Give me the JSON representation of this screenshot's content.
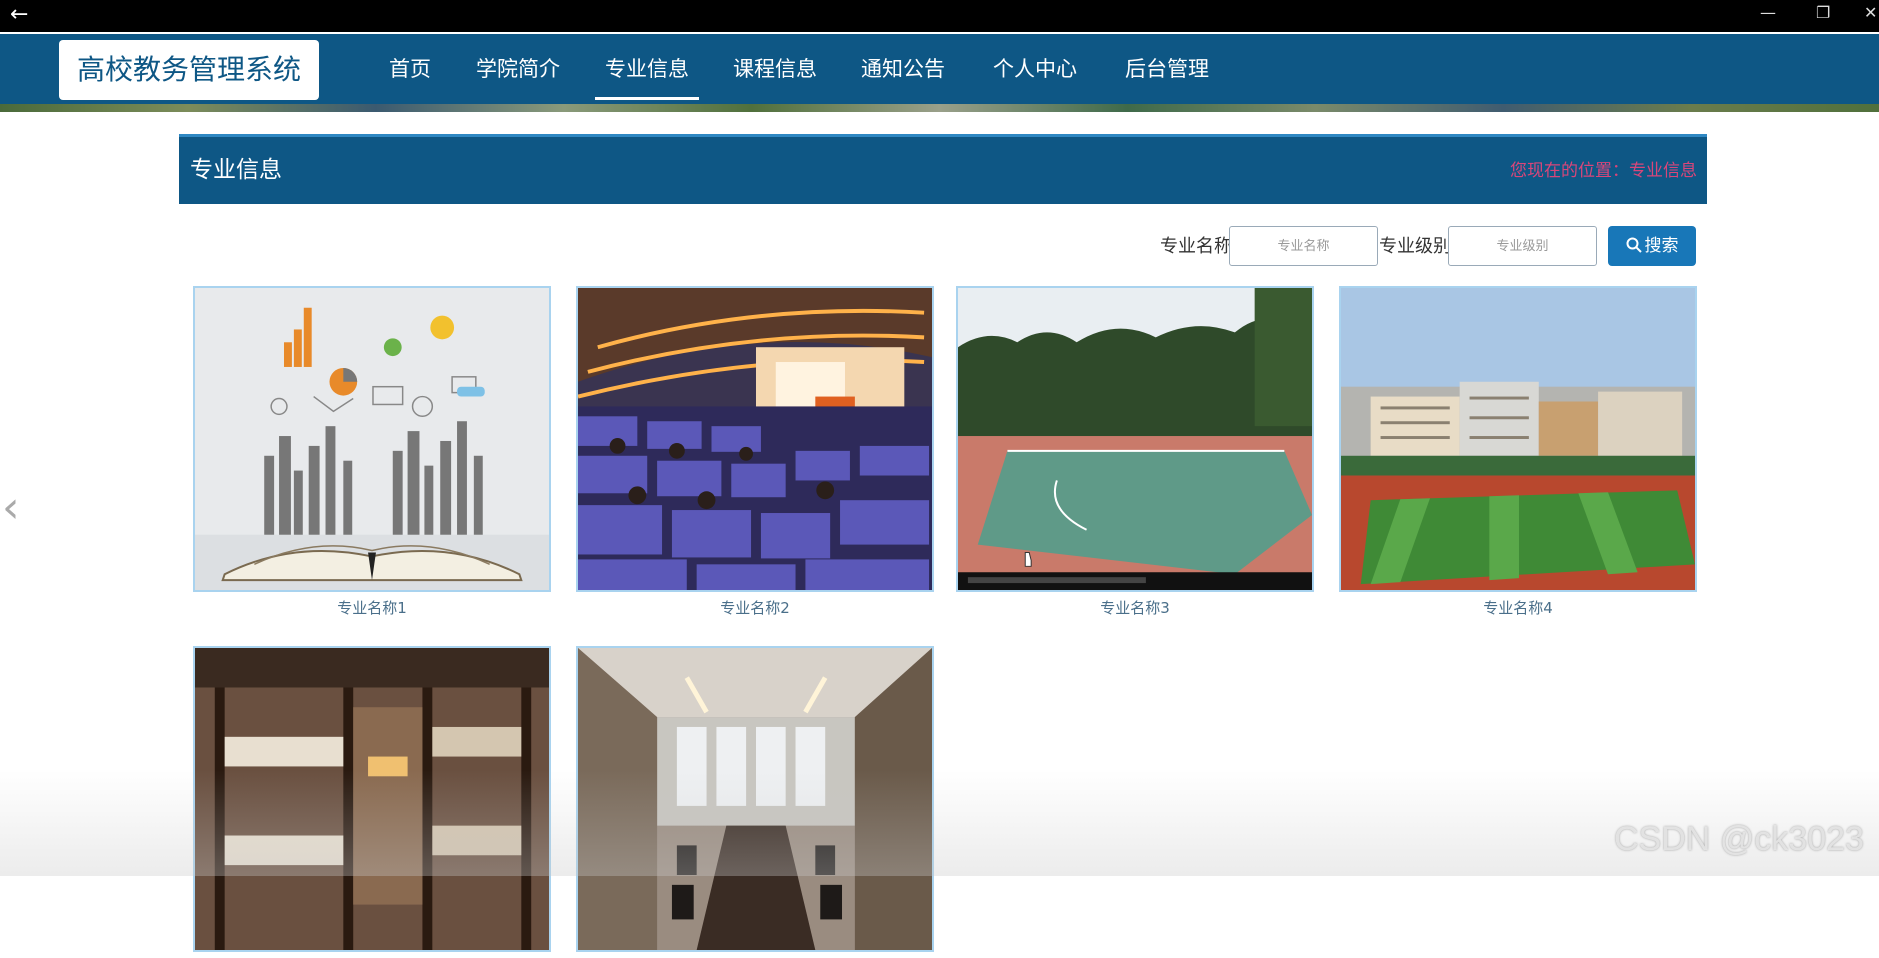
{
  "window": {
    "back_glyph": "←",
    "minimize_glyph": "—",
    "restore_glyph": "❐",
    "close_glyph": "✕"
  },
  "header": {
    "logo_text": "高校教务管理系统",
    "nav": [
      {
        "label": "首页"
      },
      {
        "label": "学院简介"
      },
      {
        "label": "专业信息"
      },
      {
        "label": "课程信息"
      },
      {
        "label": "通知公告"
      },
      {
        "label": "个人中心"
      },
      {
        "label": "后台管理"
      }
    ],
    "active_nav": "专业信息"
  },
  "section": {
    "title": "专业信息",
    "breadcrumb": "您现在的位置：专业信息"
  },
  "search": {
    "name_label": "专业名称",
    "name_placeholder": "专业名称",
    "level_label": "专业级别",
    "level_placeholder": "专业级别",
    "button_label": "搜索"
  },
  "cards": [
    {
      "caption": "专业名称1",
      "image": "book-infographic"
    },
    {
      "caption": "专业名称2",
      "image": "lecture-hall"
    },
    {
      "caption": "专业名称3",
      "image": "basketball-court"
    },
    {
      "caption": "专业名称4",
      "image": "campus-sports-field"
    },
    {
      "caption": "",
      "image": "dormitory-bunk-beds"
    },
    {
      "caption": "",
      "image": "conference-room"
    }
  ],
  "carousel": {
    "prev_glyph": "‹"
  },
  "watermark": "CSDN @ck3023",
  "colors": {
    "primary": "#0e5785",
    "button": "#1877b8",
    "breadcrumb": "#d9467a"
  }
}
